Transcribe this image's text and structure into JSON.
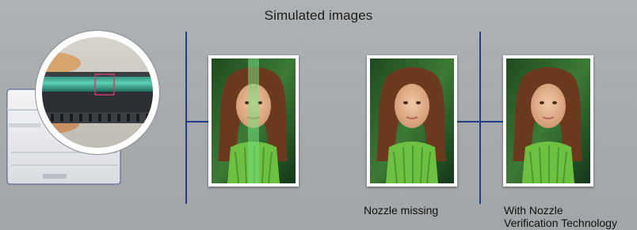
{
  "title": "Simulated images",
  "captions": {
    "nozzle_missing": "Nozzle missing",
    "with_nozzle_line1": "With Nozzle",
    "with_nozzle_line2": "Verification Technology"
  },
  "colors": {
    "background": "#a7abad",
    "connector": "#1f3f8a",
    "printer_body": "#e4e6ea",
    "magnifier_ring": "#ffffff",
    "banding_green": "#6fdc7a"
  },
  "icons": {
    "printer": "printer-illustration",
    "magnifier": "magnifier-closeup"
  }
}
